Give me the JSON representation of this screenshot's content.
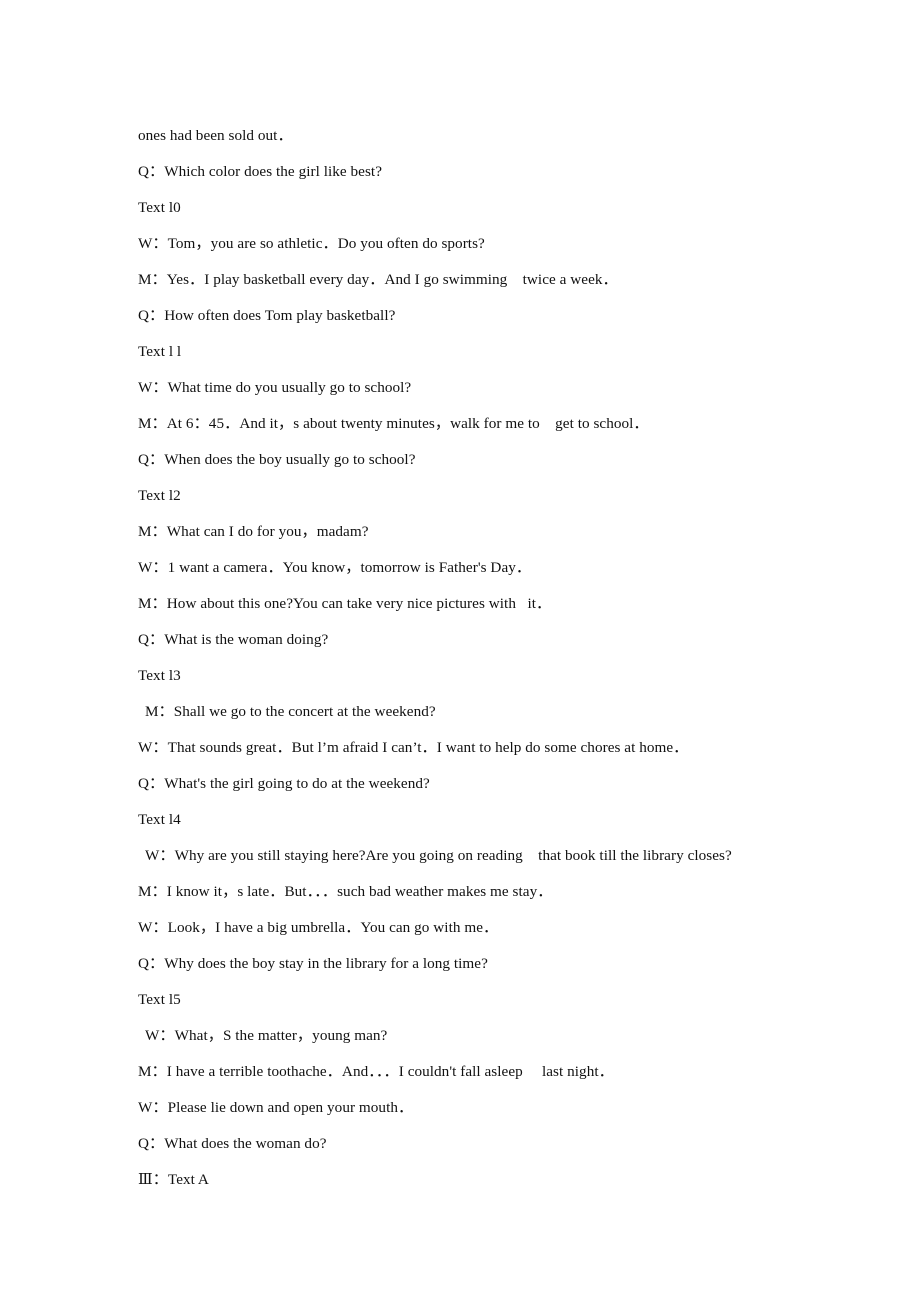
{
  "document": {
    "type": "listening-transcript",
    "page_background": "#ffffff",
    "text_color": "#111111",
    "lines": [
      {
        "id": "cont-sold-out",
        "text": "ones had been sold out．",
        "indent": false,
        "kind": "continuation"
      },
      {
        "id": "q-09",
        "text": "Q：Which color does the girl like best?",
        "indent": false,
        "kind": "question"
      },
      {
        "id": "head-text-10",
        "text": "Text l0",
        "indent": false,
        "kind": "heading"
      },
      {
        "id": "t10-w1",
        "text": "W：Tom，you are so athletic．Do you often do sports?",
        "indent": false,
        "kind": "speaker"
      },
      {
        "id": "t10-m1",
        "text": "M：Yes．I play basketball every day．And I go swimming    twice a week．",
        "indent": false,
        "kind": "speaker"
      },
      {
        "id": "t10-q",
        "text": "Q：How often does Tom play basketball?",
        "indent": false,
        "kind": "question"
      },
      {
        "id": "head-text-11",
        "text": "Text l l",
        "indent": false,
        "kind": "heading"
      },
      {
        "id": "t11-w1",
        "text": "W：What time do you usually go to school?",
        "indent": false,
        "kind": "speaker"
      },
      {
        "id": "t11-m1",
        "text": "M：At 6：45．And it，s about twenty minutes，walk for me to    get to school．",
        "indent": false,
        "kind": "speaker"
      },
      {
        "id": "t11-q",
        "text": "Q：When does the boy usually go to school?",
        "indent": false,
        "kind": "question"
      },
      {
        "id": "head-text-12",
        "text": "Text l2",
        "indent": false,
        "kind": "heading"
      },
      {
        "id": "t12-m1",
        "text": "M：What can I do for you，madam?",
        "indent": false,
        "kind": "speaker"
      },
      {
        "id": "t12-w1",
        "text": "W：1 want a camera．You know，tomorrow is Father's Day．",
        "indent": false,
        "kind": "speaker"
      },
      {
        "id": "t12-m2",
        "text": "M：How about this one?You can take very nice pictures with   it．",
        "indent": false,
        "kind": "speaker"
      },
      {
        "id": "t12-q",
        "text": "Q：What is the woman doing?",
        "indent": false,
        "kind": "question"
      },
      {
        "id": "head-text-13",
        "text": "Text l3",
        "indent": false,
        "kind": "heading"
      },
      {
        "id": "t13-m1",
        "text": "M：Shall we go to the concert at the weekend?",
        "indent": true,
        "kind": "speaker"
      },
      {
        "id": "t13-w1",
        "text": "W：That sounds great．But l’m afraid I can’t．I want to help do some chores at home．",
        "indent": false,
        "kind": "speaker"
      },
      {
        "id": "t13-q",
        "text": "Q：What's the girl going to do at the weekend?",
        "indent": false,
        "kind": "question"
      },
      {
        "id": "head-text-14",
        "text": "Text l4",
        "indent": false,
        "kind": "heading"
      },
      {
        "id": "t14-w1",
        "text": "W：Why are you still staying here?Are you going on reading    that book till the library closes?",
        "indent": true,
        "kind": "speaker"
      },
      {
        "id": "t14-m1",
        "text": "M：I know it，s late．But．．．such bad weather makes me stay．",
        "indent": false,
        "kind": "speaker"
      },
      {
        "id": "t14-w2",
        "text": "W：Look，I have a big umbrella．You can go with me．",
        "indent": false,
        "kind": "speaker"
      },
      {
        "id": "t14-q",
        "text": "Q：Why does the boy stay in the library for a long time?",
        "indent": false,
        "kind": "question"
      },
      {
        "id": "head-text-15",
        "text": "Text l5",
        "indent": false,
        "kind": "heading"
      },
      {
        "id": "t15-w1",
        "text": "W：What，S the matter，young man?",
        "indent": true,
        "kind": "speaker"
      },
      {
        "id": "t15-m1",
        "text": "M：I have a terrible toothache．And．．．I couldn't fall asleep     last night．",
        "indent": false,
        "kind": "speaker"
      },
      {
        "id": "t15-w2",
        "text": "W：Please lie down and open your mouth．",
        "indent": false,
        "kind": "speaker"
      },
      {
        "id": "t15-q",
        "text": "Q：What does the woman do?",
        "indent": false,
        "kind": "question"
      },
      {
        "id": "section-iii",
        "text": "Ⅲ：Text A",
        "indent": true,
        "kind": "section-heading"
      }
    ]
  }
}
